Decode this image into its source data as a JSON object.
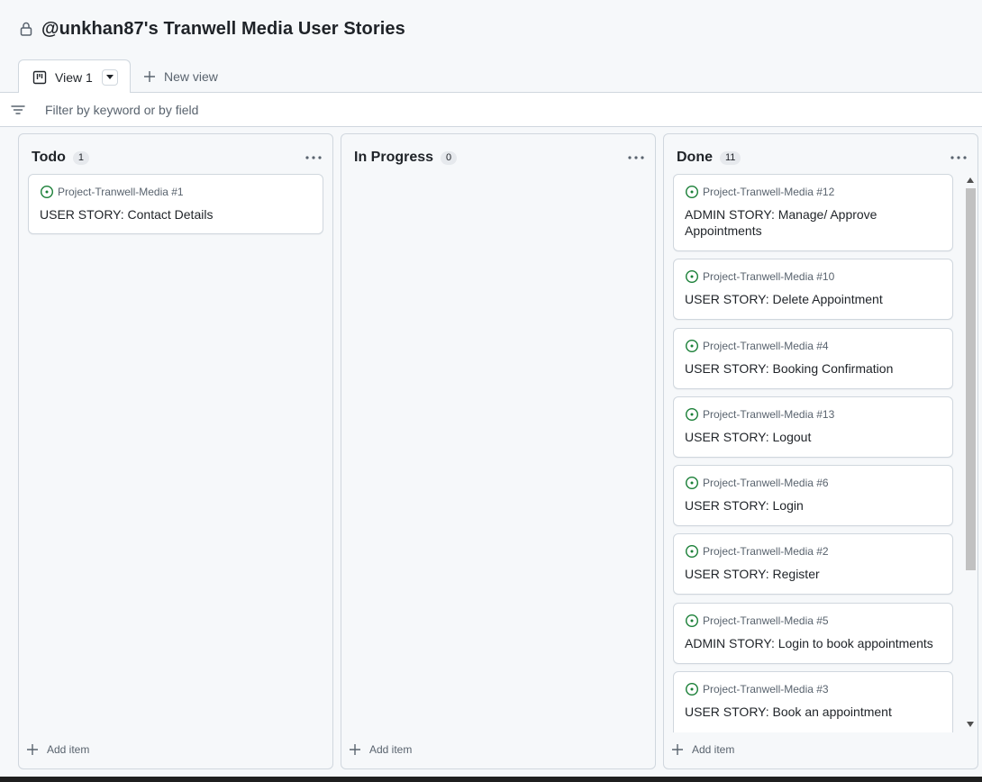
{
  "project": {
    "title": "@unkhan87's Tranwell Media User Stories"
  },
  "tabs": {
    "active_label": "View 1",
    "new_view_label": "New view"
  },
  "filter": {
    "placeholder": "Filter by keyword or by field"
  },
  "colors": {
    "issue_open": "#1a7f37",
    "border": "#d0d7de",
    "muted": "#59636e"
  },
  "columns": [
    {
      "name": "Todo",
      "count": "1",
      "add_label": "Add item",
      "cards": [
        {
          "ref": "Project-Tranwell-Media #1",
          "title": "USER STORY: Contact Details"
        }
      ]
    },
    {
      "name": "In Progress",
      "count": "0",
      "add_label": "Add item",
      "cards": []
    },
    {
      "name": "Done",
      "count": "11",
      "add_label": "Add item",
      "cards": [
        {
          "ref": "Project-Tranwell-Media #12",
          "title": "ADMIN STORY: Manage/ Approve Appointments"
        },
        {
          "ref": "Project-Tranwell-Media #10",
          "title": "USER STORY: Delete Appointment"
        },
        {
          "ref": "Project-Tranwell-Media #4",
          "title": "USER STORY: Booking Confirmation"
        },
        {
          "ref": "Project-Tranwell-Media #13",
          "title": "USER STORY: Logout"
        },
        {
          "ref": "Project-Tranwell-Media #6",
          "title": "USER STORY: Login"
        },
        {
          "ref": "Project-Tranwell-Media #2",
          "title": "USER STORY: Register"
        },
        {
          "ref": "Project-Tranwell-Media #5",
          "title": "ADMIN STORY: Login to book appointments"
        },
        {
          "ref": "Project-Tranwell-Media #3",
          "title": "USER STORY: Book an appointment"
        }
      ]
    }
  ]
}
